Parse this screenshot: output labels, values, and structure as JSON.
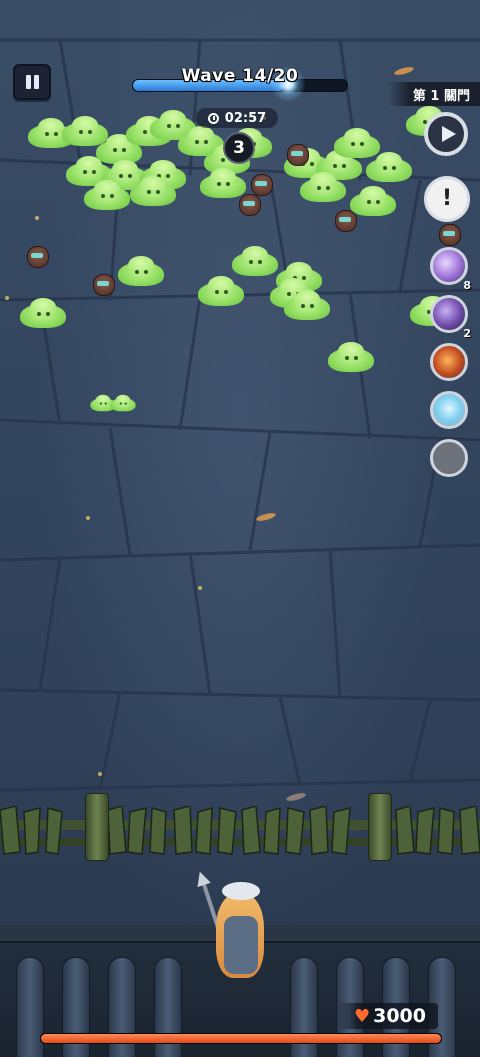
{
  "hud": {
    "wave_text": "Wave 14/20",
    "wave_progress": 0.7,
    "timer": "02:57",
    "remaining_count": "3",
    "gate_label": "第 1 關門"
  },
  "side_buttons": {
    "skills": [
      {
        "name": "purple-wing-skill",
        "level": "8"
      },
      {
        "name": "violet-blade-skill",
        "level": "2"
      },
      {
        "name": "fire-orb-skill",
        "level": ""
      },
      {
        "name": "ice-shard-skill",
        "level": ""
      },
      {
        "name": "empty-skill-slot",
        "level": ""
      }
    ]
  },
  "player": {
    "hp_text": "3000",
    "hp_fraction": 1.0
  },
  "colors": {
    "wave_fill": "#2a7ad6",
    "hp_fill": "#e24a1c",
    "slime": "#8edc5e"
  }
}
